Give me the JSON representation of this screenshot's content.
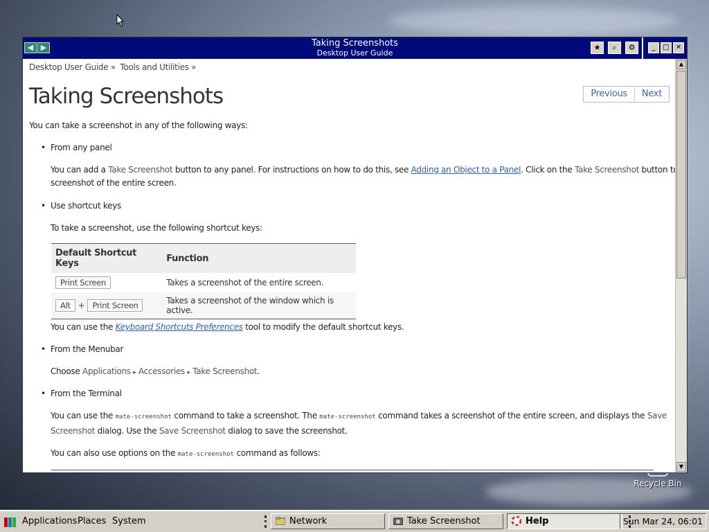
{
  "desktop": {
    "recycle_bin_label": "Recycle Bin"
  },
  "window": {
    "title": "Taking Screenshots",
    "subtitle": "Desktop User Guide",
    "nav_back_icon": "arrow-left-icon",
    "nav_forward_icon": "arrow-right-icon",
    "tool_icons": [
      "bookmark-icon",
      "find-icon",
      "settings-icon"
    ],
    "titlebar_color": "#000a7a"
  },
  "page": {
    "breadcrumbs": [
      "Desktop User Guide »",
      "Tools and Utilities »"
    ],
    "title": "Taking Screenshots",
    "previous": "Previous",
    "next": "Next",
    "intro": "You can take a screenshot in any of the following ways:",
    "s1": {
      "head": "From any panel",
      "t1": "You can add a ",
      "gui1": "Take Screenshot",
      "t2": " button to any panel. For instructions on how to do this, see ",
      "link": "Adding an Object to a Panel",
      "t3": ". Click on the ",
      "gui2": "Take Screenshot",
      "t4": " button to take a",
      "t5": "screenshot of the entire screen."
    },
    "s2": {
      "head": "Use shortcut keys",
      "intro": "To take a screenshot, use the following shortcut keys:",
      "table": {
        "col1": "Default Shortcut Keys",
        "col2": "Function",
        "row1_key": "Print Screen",
        "row1_fn": "Takes a screenshot of the entire screen.",
        "row2_key1": "Alt",
        "row2_plus": "+",
        "row2_key2": "Print Screen",
        "row2_fn": "Takes a screenshot of the window which is active."
      },
      "after1": "You can use the ",
      "after_link": "Keyboard Shortcuts Preferences",
      "after2": " tool to modify the default shortcut keys."
    },
    "s3": {
      "head": "From the Menubar",
      "t1": "Choose ",
      "m1": "Applications",
      "arrow": "▸",
      "m2": "Accessories",
      "m3": "Take Screenshot",
      "t2": "."
    },
    "s4": {
      "head": "From the Terminal",
      "t1": "You can use the ",
      "code1": "mate-screenshot",
      "t2": " command to take a screenshot. The ",
      "code2": "mate-screenshot",
      "t3": " command takes a screenshot of the entire screen, and displays the ",
      "gui1": "Save",
      "gui1b": "Screenshot",
      "t4": " dialog. Use the ",
      "gui2": "Save Screenshot",
      "t5": " dialog to save the screenshot.",
      "t6": "You can also use options on the ",
      "code3": "mate-screenshot",
      "t7": " command as follows:"
    }
  },
  "taskbar": {
    "applications": "Applications",
    "places": "Places",
    "system": "System",
    "tasks": [
      {
        "label": "Network",
        "icon": "folder-icon"
      },
      {
        "label": "Take Screenshot",
        "icon": "camera-icon"
      },
      {
        "label": "Help",
        "icon": "help-icon"
      }
    ],
    "clock": "Sun Mar 24, 06:01"
  }
}
